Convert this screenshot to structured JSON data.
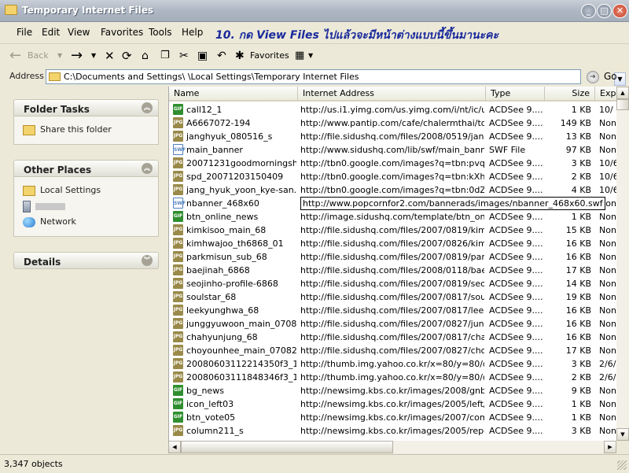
{
  "window": {
    "title": "Temporary Internet Files"
  },
  "menubar": {
    "items": [
      "File",
      "Edit",
      "View",
      "Favorites",
      "Tools",
      "Help"
    ]
  },
  "caption": "10. กด View Files ไปแล้วจะมีหน้าต่างแบบนี้ขึ้นมานะคะ",
  "toolbar": {
    "back": "Back",
    "favorites": "Favorites",
    "icons": [
      "back-arrow-icon",
      "forward-arrow-icon",
      "stop-icon",
      "refresh-icon",
      "home-icon",
      "copy-icon",
      "cut-icon",
      "paste-icon",
      "undo-icon",
      "favorites-star-icon",
      "views-icon"
    ]
  },
  "address": {
    "label": "Address",
    "path": "C:\\Documents and Settings\\      \\Local Settings\\Temporary Internet Files",
    "go_label": "Go"
  },
  "panels": {
    "folder_tasks": {
      "title": "Folder Tasks",
      "links": [
        "Share this folder"
      ]
    },
    "other_places": {
      "title": "Other Places",
      "links": [
        "Local Settings",
        "",
        "Network"
      ]
    },
    "details": {
      "title": "Details"
    }
  },
  "columns": [
    "Name",
    "Internet Address",
    "Type",
    "Size",
    "Exp"
  ],
  "files": [
    {
      "icon": "gif",
      "name": "call12_1",
      "url": "http://us.i1.yimg.com/us.yimg.com/i/nt/ic/ut...",
      "type": "ACDSee 9....",
      "size": "1 KB",
      "exp": "10/"
    },
    {
      "icon": "jpg",
      "name": "A6667072-194",
      "url": "http://www.pantip.com/cafe/chalermthai/to...",
      "type": "ACDSee 9....",
      "size": "149 KB",
      "exp": "Non"
    },
    {
      "icon": "jpg",
      "name": "janghyuk_080516_s",
      "url": "http://file.sidushq.com/files/2008/0519/jang...",
      "type": "ACDSee 9....",
      "size": "13 KB",
      "exp": "Non"
    },
    {
      "icon": "swf",
      "name": "main_banner",
      "url": "http://www.sidushq.com/lib/swf/main_banne...",
      "type": "SWF File",
      "size": "97 KB",
      "exp": "Non"
    },
    {
      "icon": "jpg",
      "name": "20071231goodmorningsh...",
      "url": "http://tbn0.google.com/images?q=tbn:pvqh...",
      "type": "ACDSee 9....",
      "size": "3 KB",
      "exp": "10/6"
    },
    {
      "icon": "jpg",
      "name": "spd_20071203150409",
      "url": "http://tbn0.google.com/images?q=tbn:kXhF...",
      "type": "ACDSee 9....",
      "size": "2 KB",
      "exp": "10/6"
    },
    {
      "icon": "jpg",
      "name": "jang_hyuk_yoon_kye-san...",
      "url": "http://tbn0.google.com/images?q=tbn:0dZK...",
      "type": "ACDSee 9....",
      "size": "4 KB",
      "exp": "10/6"
    },
    {
      "icon": "swf",
      "name": "nbanner_468x60",
      "url": "http://www.popcornfor2.com/bannerads/images/nbanner_468x60.swf",
      "type": "",
      "size": "3 KB",
      "exp": "Non",
      "tooltip": true
    },
    {
      "icon": "gif",
      "name": "btn_online_news",
      "url": "http://image.sidushq.com/template/btn_onli...",
      "type": "ACDSee 9....",
      "size": "1 KB",
      "exp": "Non"
    },
    {
      "icon": "jpg",
      "name": "kimkisoo_main_68",
      "url": "http://file.sidushq.com/files/2007/0819/kimki...",
      "type": "ACDSee 9....",
      "size": "15 KB",
      "exp": "Non"
    },
    {
      "icon": "jpg",
      "name": "kimhwajoo_th6868_01",
      "url": "http://file.sidushq.com/files/2007/0826/kimh...",
      "type": "ACDSee 9....",
      "size": "16 KB",
      "exp": "Non"
    },
    {
      "icon": "jpg",
      "name": "parkmisun_sub_68",
      "url": "http://file.sidushq.com/files/2007/0819/park...",
      "type": "ACDSee 9....",
      "size": "16 KB",
      "exp": "Non"
    },
    {
      "icon": "jpg",
      "name": "baejinah_6868",
      "url": "http://file.sidushq.com/files/2008/0118/baeji...",
      "type": "ACDSee 9....",
      "size": "17 KB",
      "exp": "Non"
    },
    {
      "icon": "jpg",
      "name": "seojinho-profile-6868",
      "url": "http://file.sidushq.com/files/2007/0819/seoji...",
      "type": "ACDSee 9....",
      "size": "14 KB",
      "exp": "Non"
    },
    {
      "icon": "jpg",
      "name": "soulstar_68",
      "url": "http://file.sidushq.com/files/2007/0817/souls...",
      "type": "ACDSee 9....",
      "size": "19 KB",
      "exp": "Non"
    },
    {
      "icon": "jpg",
      "name": "leekyunghwa_68",
      "url": "http://file.sidushq.com/files/2007/0817/leek...",
      "type": "ACDSee 9....",
      "size": "16 KB",
      "exp": "Non"
    },
    {
      "icon": "jpg",
      "name": "junggyuwoon_main_0708...",
      "url": "http://file.sidushq.com/files/2007/0827/jung...",
      "type": "ACDSee 9....",
      "size": "16 KB",
      "exp": "Non"
    },
    {
      "icon": "jpg",
      "name": "chahyunjung_68",
      "url": "http://file.sidushq.com/files/2007/0817/chah...",
      "type": "ACDSee 9....",
      "size": "16 KB",
      "exp": "Non"
    },
    {
      "icon": "jpg",
      "name": "choyounhee_main_07082...",
      "url": "http://file.sidushq.com/files/2007/0827/choy...",
      "type": "ACDSee 9....",
      "size": "17 KB",
      "exp": "Non"
    },
    {
      "icon": "jpg",
      "name": "20080603112214350f3_1...",
      "url": "http://thumb.img.yahoo.co.kr/x=80/y=80/q...",
      "type": "ACDSee 9....",
      "size": "3 KB",
      "exp": "2/6/"
    },
    {
      "icon": "jpg",
      "name": "20080603111848346f3_1...",
      "url": "http://thumb.img.yahoo.co.kr/x=80/y=80/q...",
      "type": "ACDSee 9....",
      "size": "2 KB",
      "exp": "2/6/"
    },
    {
      "icon": "gif",
      "name": "bg_news",
      "url": "http://newsimg.kbs.co.kr/images/2008/gnb_...",
      "type": "ACDSee 9....",
      "size": "9 KB",
      "exp": "Non"
    },
    {
      "icon": "gif",
      "name": "icon_left03",
      "url": "http://newsimg.kbs.co.kr/images/2005/left/i...",
      "type": "ACDSee 9....",
      "size": "1 KB",
      "exp": "Non"
    },
    {
      "icon": "gif",
      "name": "btn_vote05",
      "url": "http://newsimg.kbs.co.kr/images/2007/com...",
      "type": "ACDSee 9....",
      "size": "1 KB",
      "exp": "Non"
    },
    {
      "icon": "jpg",
      "name": "column211_s",
      "url": "http://newsimg.kbs.co.kr/images/2005/repor...",
      "type": "ACDSee 9....",
      "size": "3 KB",
      "exp": "Non"
    }
  ],
  "status": {
    "count": "3,347 objects"
  }
}
